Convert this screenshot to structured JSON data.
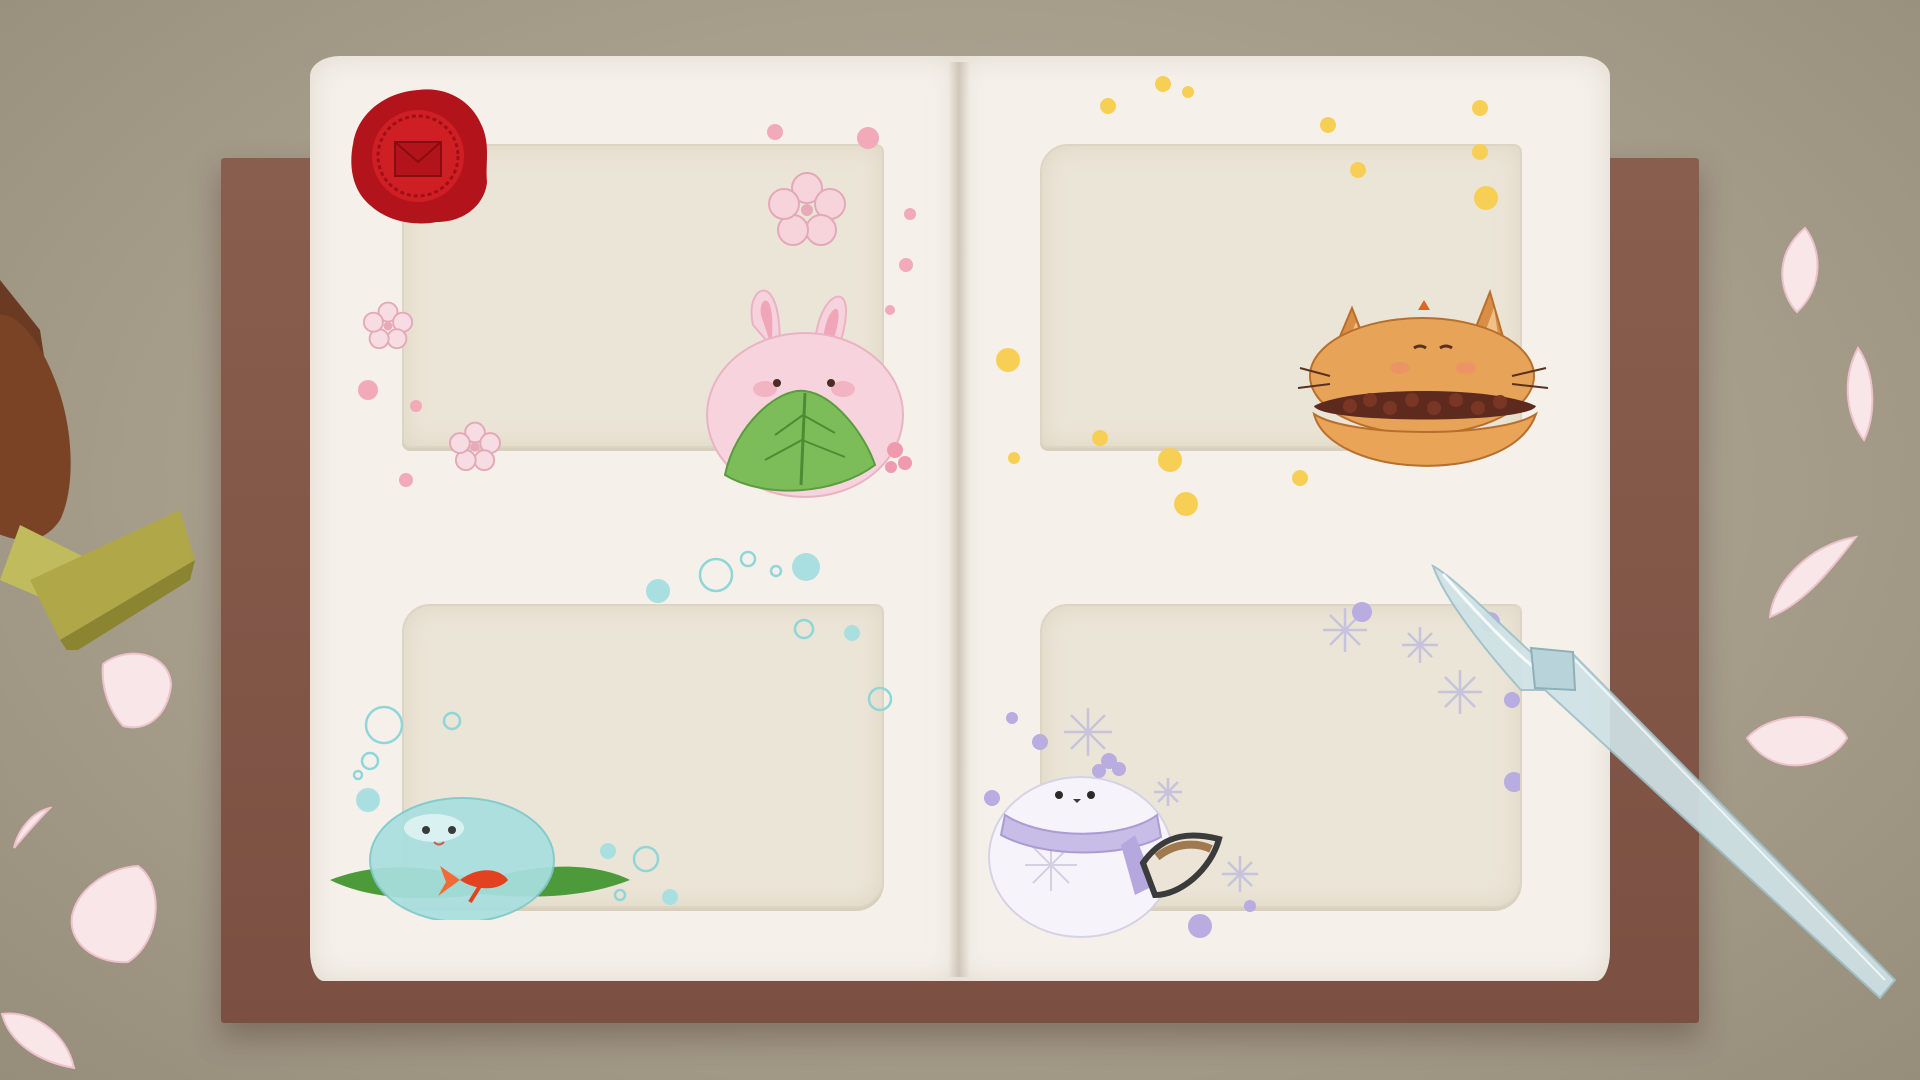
{
  "scene": {
    "type": "album-book",
    "pages": [
      {
        "side": "left",
        "cards": [
          {
            "slot": 1,
            "character": "rabbit-mochi-icon",
            "theme": "spring",
            "accent": "#f5c4cc"
          },
          {
            "slot": 3,
            "character": "water-mochi-goldfish-icon",
            "theme": "summer",
            "accent": "#a9dfe0"
          }
        ]
      },
      {
        "side": "right",
        "cards": [
          {
            "slot": 2,
            "character": "cat-dorayaki-icon",
            "theme": "autumn",
            "accent": "#f6c850"
          },
          {
            "slot": 4,
            "character": "snow-bird-mochi-icon",
            "theme": "winter",
            "accent": "#c3b8e6"
          }
        ]
      }
    ],
    "props": [
      "wax-seal-icon",
      "wax-stamp-icon",
      "glass-pen-icon",
      "sakura-petal-icon"
    ]
  },
  "colors": {
    "table": "#a89e8c",
    "cover": "#7b5042",
    "paper": "#f5f1ea",
    "card": "#ebe5d7",
    "wax": "#c0141c"
  }
}
